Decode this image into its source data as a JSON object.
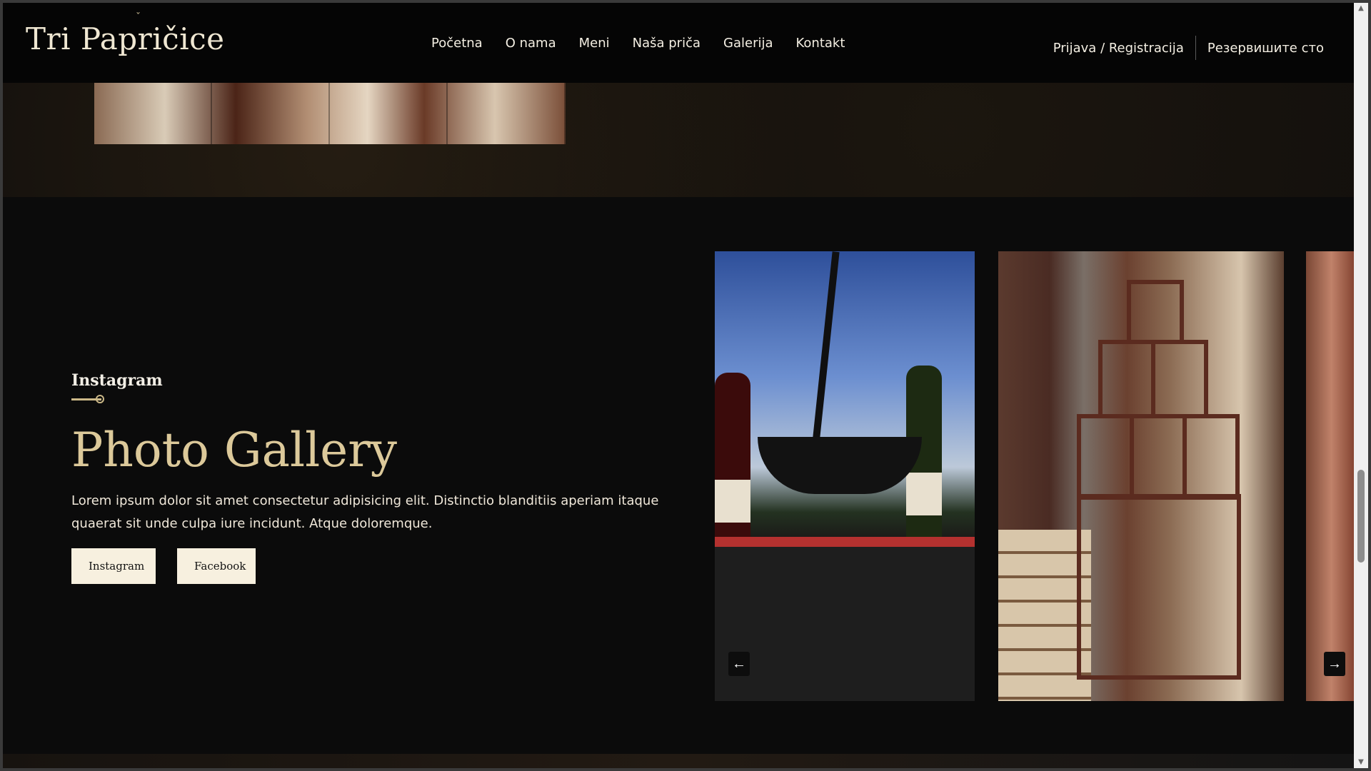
{
  "header": {
    "brand": "Tri Papričice",
    "brand_mark": "ˇ",
    "nav": [
      "Početna",
      "O nama",
      "Meni",
      "Naša priča",
      "Galerija",
      "Kontakt"
    ],
    "login": "Prijava / Registracija",
    "reserve": "Резервишите сто"
  },
  "gallery": {
    "eyebrow": "Instagram",
    "title": "Photo Gallery",
    "description": "Lorem ipsum dolor sit amet consectetur adipisicing elit. Distinctio blanditiis aperiam itaque quaerat sit unde culpa iure incidunt. Atque doloremque.",
    "buttons": {
      "instagram": "Instagram",
      "facebook": "Facebook"
    },
    "arrows": {
      "prev": "←",
      "next": "→"
    }
  },
  "scrollbar": {
    "up": "▲",
    "down": "▼"
  },
  "colors": {
    "background": "#0b0b0b",
    "accent": "#dcc99a",
    "button_bg": "#f7f0df"
  }
}
